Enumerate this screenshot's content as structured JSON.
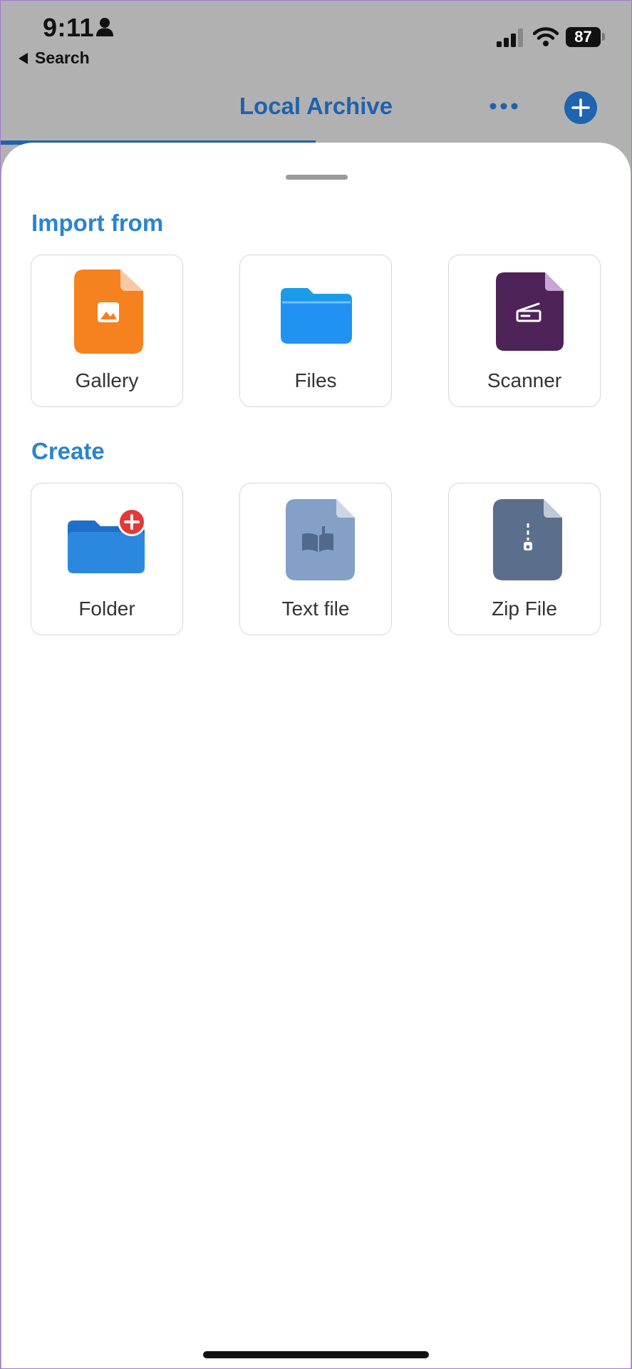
{
  "status_bar": {
    "time": "9:11",
    "back_label": "Search",
    "battery": "87"
  },
  "header": {
    "title": "Local Archive",
    "more_icon": "more-horizontal-icon",
    "add_icon": "plus-circle-icon"
  },
  "sheet": {
    "import_section": {
      "title": "Import from",
      "items": [
        {
          "label": "Gallery",
          "icon": "image-file-icon",
          "color": "#f5821f"
        },
        {
          "label": "Files",
          "icon": "folder-icon",
          "color": "#1e88f0"
        },
        {
          "label": "Scanner",
          "icon": "scanner-file-icon",
          "color": "#4e2458"
        }
      ]
    },
    "create_section": {
      "title": "Create",
      "items": [
        {
          "label": "Folder",
          "icon": "new-folder-icon",
          "color": "#2b88de"
        },
        {
          "label": "Text file",
          "icon": "text-file-icon",
          "color": "#84a0c6"
        },
        {
          "label": "Zip File",
          "icon": "zip-file-icon",
          "color": "#5b6f8c"
        }
      ]
    }
  },
  "colors": {
    "accent": "#1f62ad",
    "section_title": "#2a84cf",
    "overlay_background": "#b1b1b1"
  }
}
